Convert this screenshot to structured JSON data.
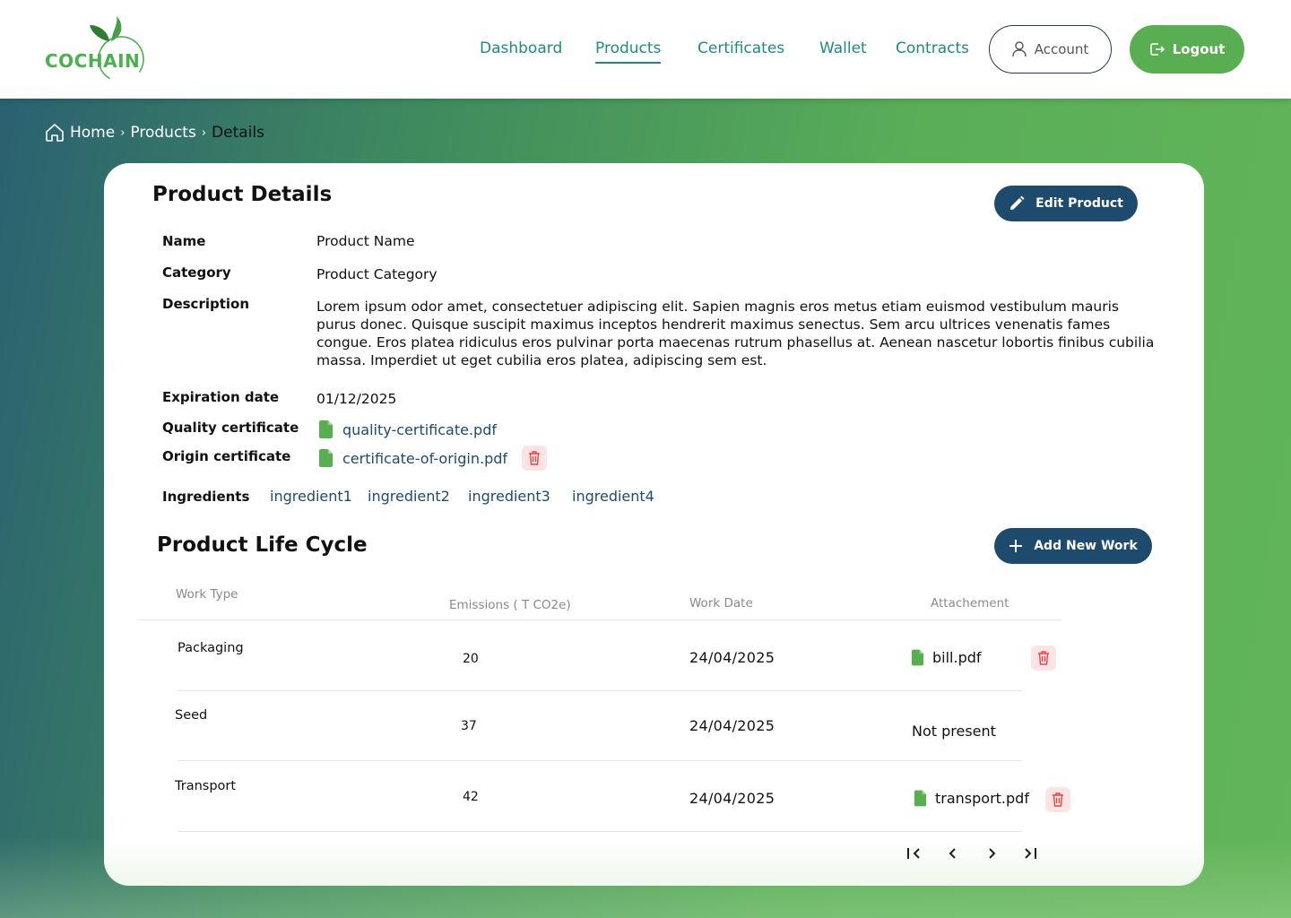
{
  "brand": {
    "name": "COCHAIN",
    "color": "#4caf50"
  },
  "nav": {
    "items": [
      {
        "label": "Dashboard",
        "active": false
      },
      {
        "label": "Products",
        "active": true
      },
      {
        "label": "Certificates",
        "active": false
      },
      {
        "label": "Wallet",
        "active": false
      },
      {
        "label": "Contracts",
        "active": false
      }
    ],
    "account_label": "Account",
    "logout_label": "Logout"
  },
  "breadcrumb": {
    "home": "Home",
    "products": "Products",
    "current": "Details"
  },
  "details": {
    "title": "Product Details",
    "edit_label": "Edit Product",
    "name_label": "Name",
    "name_value": "Product Name",
    "category_label": "Category",
    "category_value": "Product Category",
    "description_label": "Description",
    "description_value": "Lorem ipsum odor amet, consectetuer adipiscing elit. Sapien magnis eros  metus etiam euismod vestibulum mauris purus donec. Quisque suscipit  maximus inceptos hendrerit maximus senectus. Sem arcu ultrices venenatis fames congue. Eros platea ridiculus eros pulvinar porta maecenas rutrum phasellus at. Aenean nascetur lobortis finibus cubilia massa. Imperdiet ut eget cubilia eros platea, adipiscing sem est.",
    "expiration_label": "Expiration date",
    "expiration_value": "01/12/2025",
    "quality_label": "Quality certificate",
    "quality_file": "quality-certificate.pdf",
    "origin_label": "Origin certificate",
    "origin_file": "certificate-of-origin.pdf",
    "ingredients_label": "Ingredients",
    "ingredients": [
      "ingredient1",
      "ingredient2",
      "ingredient3",
      "ingredient4"
    ]
  },
  "lifecycle": {
    "title": "Product Life Cycle",
    "add_label": "Add New Work",
    "columns": [
      "Work Type",
      "Emissions ( T CO2e)",
      "Work Date",
      "Attachement"
    ],
    "rows": [
      {
        "type": "Packaging",
        "emissions": "20",
        "date": "24/04/2025",
        "attachment": "bill.pdf",
        "has_file": true
      },
      {
        "type": "Seed",
        "emissions": "37",
        "date": "24/04/2025",
        "attachment": "Not present",
        "has_file": false
      },
      {
        "type": "Transport",
        "emissions": "42",
        "date": "24/04/2025",
        "attachment": "transport.pdf",
        "has_file": true
      }
    ]
  },
  "colors": {
    "primary": "#1e4a6d",
    "accent_green": "#5aae52",
    "nav_teal": "#1f8a83",
    "trash_bg": "#fde3e3",
    "trash_red": "#e04848"
  }
}
